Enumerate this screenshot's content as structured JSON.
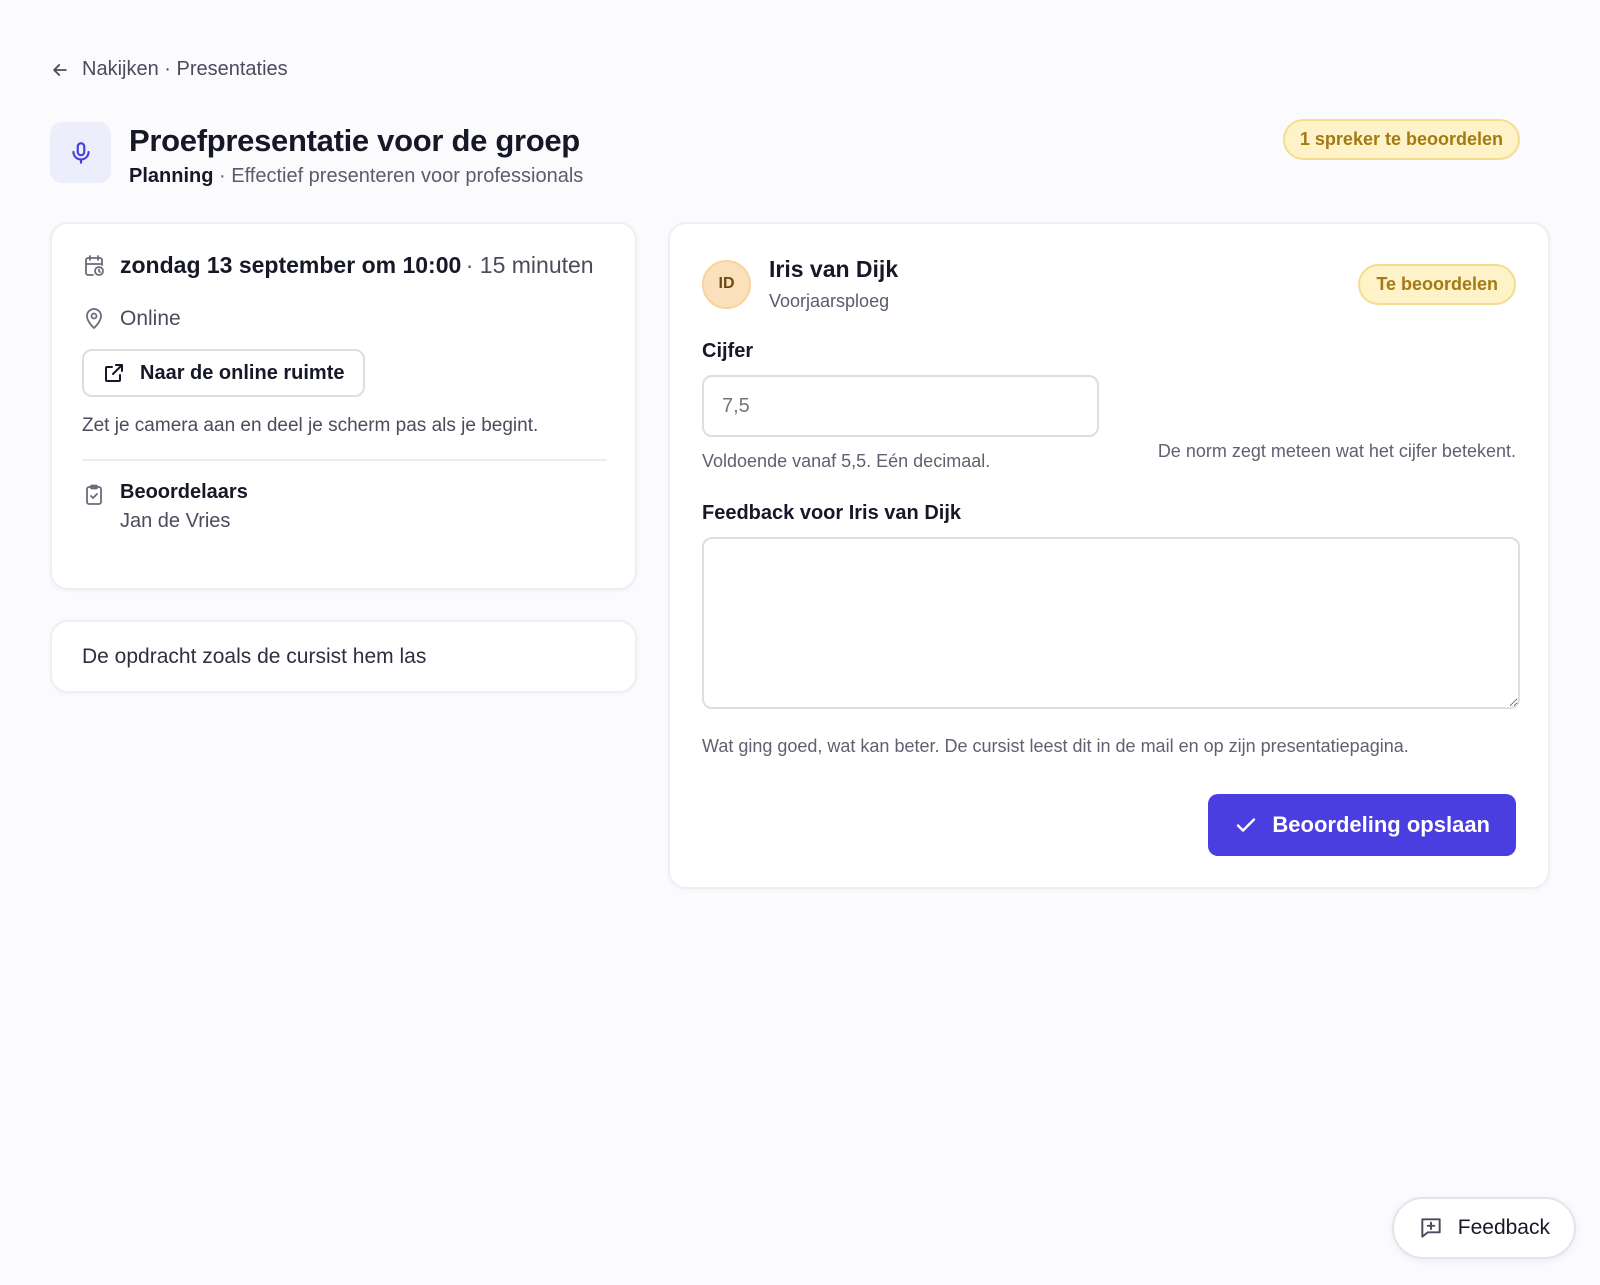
{
  "breadcrumb": {
    "label": "Nakijken · Presentaties"
  },
  "header": {
    "title": "Proefpresentatie voor de groep",
    "subtitle_strong": "Planning",
    "subtitle_rest": " · Effectief presenteren voor professionals",
    "badge": "1 spreker te beoordelen"
  },
  "session": {
    "datetime": "zondag 13 september om 10:00",
    "duration": "· 15 minuten",
    "location": "Online",
    "room_button": "Naar de online ruimte",
    "hint": "Zet je camera aan en deel je scherm pas als je begint.",
    "graders_title": "Beoordelaars",
    "graders_name": "Jan de Vries"
  },
  "task": {
    "label": "De opdracht zoals de cursist hem las"
  },
  "student": {
    "initials": "ID",
    "name": "Iris van Dijk",
    "group": "Voorjaarsploeg",
    "status": "Te beoordelen"
  },
  "grade": {
    "label": "Cijfer",
    "placeholder": "7,5",
    "help": "Voldoende vanaf 5,5. Eén decimaal.",
    "norm": "De norm zegt meteen wat het cijfer betekent."
  },
  "feedback": {
    "label": "Feedback voor Iris van Dijk",
    "help": "Wat ging goed, wat kan beter. De cursist leest dit in de mail en op zijn presentatiepagina."
  },
  "actions": {
    "save": "Beoordeling opslaan",
    "feedback_float": "Feedback"
  },
  "colors": {
    "accent": "#4a3ee0",
    "badge_bg": "#fdf2c8",
    "badge_text": "#a47a12"
  }
}
